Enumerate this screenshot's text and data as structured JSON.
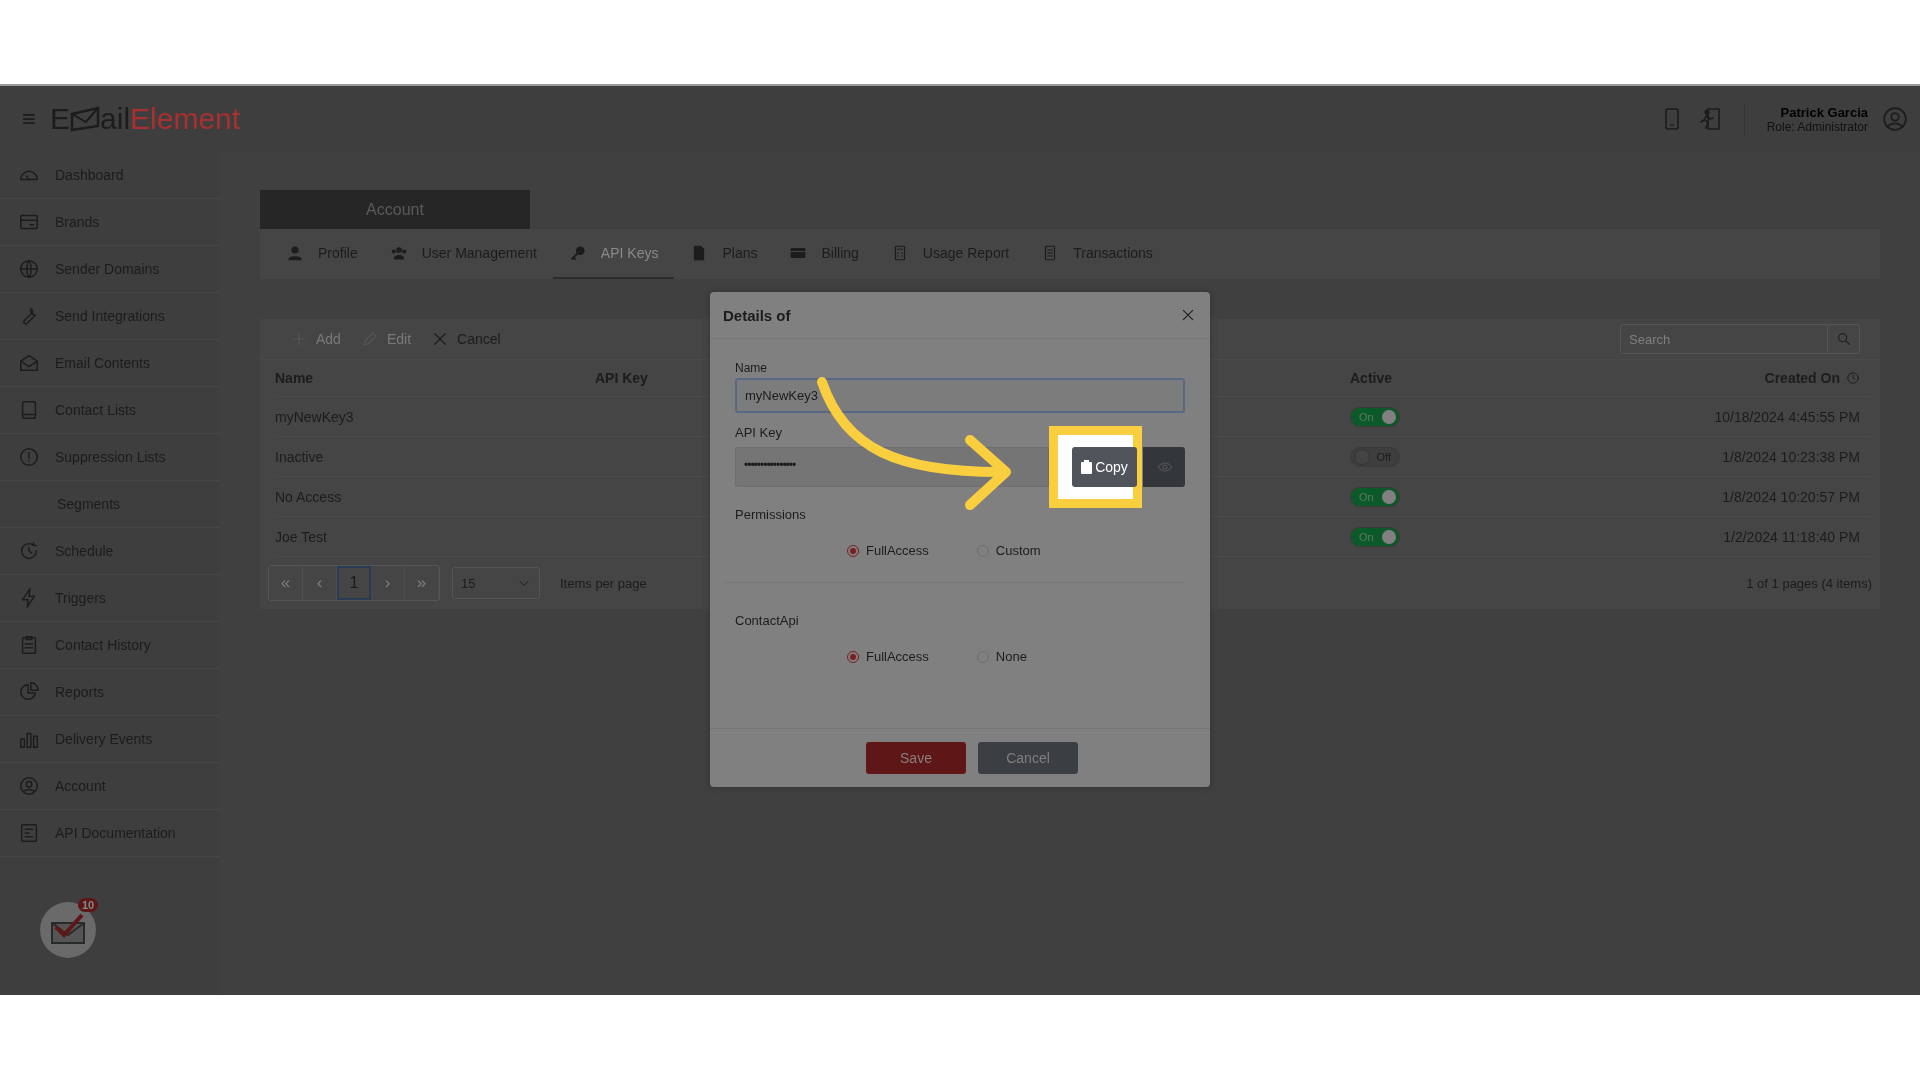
{
  "header": {
    "menu_glyph": "≡",
    "logo": {
      "prefix": "E",
      "middle": "ail",
      "accent": "Element"
    },
    "user": {
      "name": "Patrick Garcia",
      "role": "Role: Administrator"
    }
  },
  "sidebar": {
    "items": [
      {
        "label": "Dashboard"
      },
      {
        "label": "Brands"
      },
      {
        "label": "Sender Domains"
      },
      {
        "label": "Send Integrations"
      },
      {
        "label": "Email Contents"
      },
      {
        "label": "Contact Lists"
      },
      {
        "label": "Suppression Lists"
      },
      {
        "label": "Segments"
      },
      {
        "label": "Schedule"
      },
      {
        "label": "Triggers"
      },
      {
        "label": "Contact History"
      },
      {
        "label": "Reports"
      },
      {
        "label": "Delivery Events"
      },
      {
        "label": "Account"
      },
      {
        "label": "API Documentation"
      }
    ],
    "notification_count": "10"
  },
  "account_header": "Account",
  "tabs": [
    {
      "label": "Profile",
      "selected": false
    },
    {
      "label": "User Management",
      "selected": false
    },
    {
      "label": "API Keys",
      "selected": true
    },
    {
      "label": "Plans",
      "selected": false
    },
    {
      "label": "Billing",
      "selected": false
    },
    {
      "label": "Usage Report",
      "selected": false
    },
    {
      "label": "Transactions",
      "selected": false
    }
  ],
  "toolbar": [
    {
      "label": "Add",
      "disabled": true
    },
    {
      "label": "Edit",
      "disabled": true
    },
    {
      "label": "Cancel",
      "disabled": false
    }
  ],
  "search": {
    "placeholder": "Search"
  },
  "table": {
    "columns": [
      "Name",
      "API Key",
      "Active",
      "Created On"
    ],
    "rows": [
      {
        "name": "myNewKey3",
        "active": {
          "on": true,
          "label": "On"
        },
        "created": "10/18/2024 4:45:55 PM"
      },
      {
        "name": "Inactive",
        "active": {
          "on": false,
          "label": "Off"
        },
        "created": "1/8/2024 10:23:38 PM"
      },
      {
        "name": "No Access",
        "active": {
          "on": true,
          "label": "On"
        },
        "created": "1/8/2024 10:20:57 PM"
      },
      {
        "name": "Joe Test",
        "active": {
          "on": true,
          "label": "On"
        },
        "created": "1/2/2024 11:18:40 PM"
      }
    ]
  },
  "pager": {
    "buttons": [
      {
        "label": "«",
        "selected": false
      },
      {
        "label": "‹",
        "selected": false
      },
      {
        "label": "1",
        "selected": true
      },
      {
        "label": "›",
        "selected": false
      },
      {
        "label": "»",
        "selected": false
      }
    ],
    "page_size": "15",
    "page_size_label": "Items per page",
    "summary": "1 of 1 pages (4 items)"
  },
  "modal": {
    "title": "Details of",
    "name_label": "Name",
    "name_value": "myNewKey3",
    "api_key_label": "API Key",
    "api_key_value": "••••••••••••••••",
    "copy_label": "Copy",
    "groups": [
      {
        "label": "Permissions",
        "options": [
          {
            "label": "FullAccess",
            "selected": true
          },
          {
            "label": "Custom",
            "selected": false
          }
        ]
      },
      {
        "label": "ContactApi",
        "options": [
          {
            "label": "FullAccess",
            "selected": true
          },
          {
            "label": "None",
            "selected": false
          }
        ]
      }
    ],
    "save": "Save",
    "cancel": "Cancel"
  }
}
